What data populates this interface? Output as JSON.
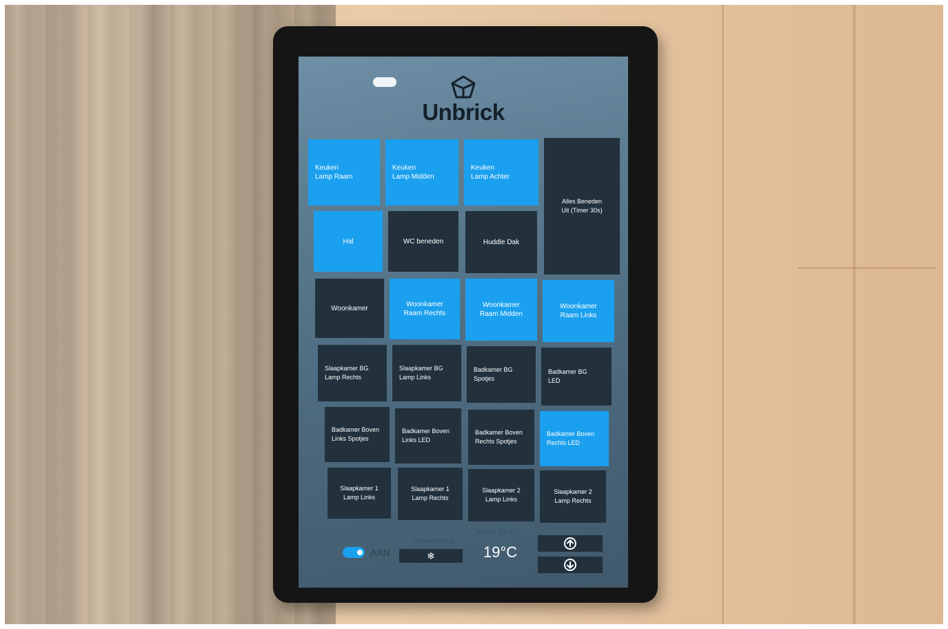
{
  "brand": {
    "name": "Unbrick",
    "logo_icon": "cube-icon"
  },
  "colors": {
    "tile_on": "#1aa0ee",
    "tile_off": "#22313c",
    "screen": "#5d7d93"
  },
  "tiles": [
    {
      "label_line1": "Keuken",
      "label_line2": "Lamp Raam",
      "state": "on"
    },
    {
      "label_line1": "Keuken",
      "label_line2": "Lamp Midden",
      "state": "on"
    },
    {
      "label_line1": "Keuken",
      "label_line2": "Lamp Achter",
      "state": "on"
    },
    {
      "label_line1": "Alles Beneden",
      "label_line2": "Uit (Timer 30s)",
      "state": "off"
    },
    {
      "label_line1": "Hal",
      "label_line2": "",
      "state": "on"
    },
    {
      "label_line1": "WC beneden",
      "label_line2": "",
      "state": "off"
    },
    {
      "label_line1": "Huddle Dak",
      "label_line2": "",
      "state": "off"
    },
    {
      "label_line1": "Woonkamer",
      "label_line2": "",
      "state": "off"
    },
    {
      "label_line1": "Woonkamer",
      "label_line2": "Raam Rechts",
      "state": "on"
    },
    {
      "label_line1": "Woonkamer",
      "label_line2": "Raam Midden",
      "state": "on"
    },
    {
      "label_line1": "Woonkamer",
      "label_line2": "Raam Links",
      "state": "on"
    },
    {
      "label_line1": "Slaapkamer BG",
      "label_line2": "Lamp Rechts",
      "state": "off"
    },
    {
      "label_line1": "Slaapkamer BG",
      "label_line2": "Lamp Links",
      "state": "off"
    },
    {
      "label_line1": "Badkamer BG",
      "label_line2": "Spotjes",
      "state": "off"
    },
    {
      "label_line1": "Badkamer BG",
      "label_line2": "LED",
      "state": "off"
    },
    {
      "label_line1": "Badkamer Boven",
      "label_line2": "Links Spotjes",
      "state": "off"
    },
    {
      "label_line1": "Badkamer Boven",
      "label_line2": "Links LED",
      "state": "off"
    },
    {
      "label_line1": "Badkamer Boven",
      "label_line2": "Rechts Spotjes",
      "state": "off"
    },
    {
      "label_line1": "Badkamer Boven",
      "label_line2": "Rechts LED",
      "state": "on"
    },
    {
      "label_line1": "Slaapkamer 1",
      "label_line2": "Lamp Links",
      "state": "off"
    },
    {
      "label_line1": "Slaapkamer 1",
      "label_line2": "Lamp Rechts",
      "state": "off"
    },
    {
      "label_line1": "Slaapkamer 2",
      "label_line2": "Lamp Links",
      "state": "off"
    },
    {
      "label_line1": "Slaapkamer 2",
      "label_line2": "Lamp Rechts",
      "state": "off"
    }
  ],
  "climate": {
    "toggle_label": "AAN",
    "toggle_on": true,
    "mode_label": "Airconditioning",
    "mode_icon": "snowflake-icon",
    "mode_glyph": "❄",
    "room_temp": "Kamer 24,1°C",
    "setpoint": "19°C",
    "up_icon": "arrow-up-circle-icon",
    "down_icon": "arrow-down-circle-icon"
  }
}
